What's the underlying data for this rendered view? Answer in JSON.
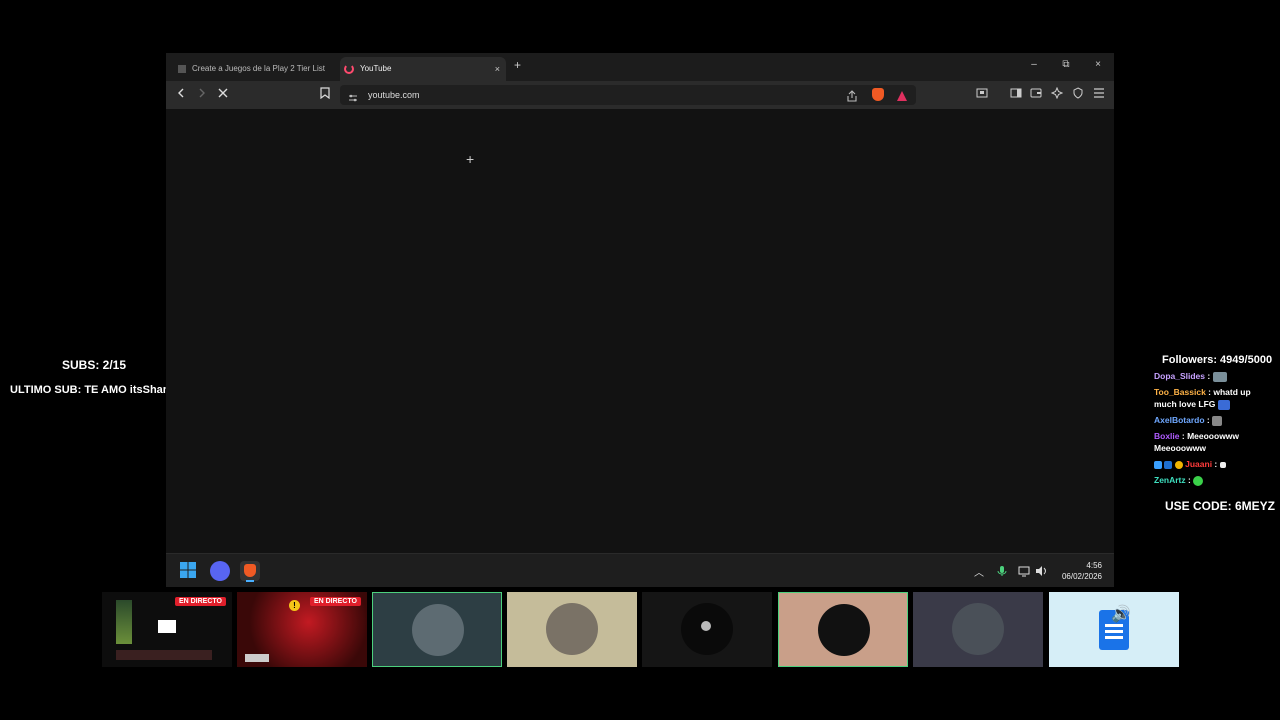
{
  "browser": {
    "tabs": [
      {
        "title": "Create a Juegos de la Play 2 Tier List"
      },
      {
        "title": "YouTube"
      }
    ],
    "url": "youtube.com",
    "icons": {
      "new_tab": "+",
      "close_tab": "×",
      "minimize": "–",
      "restore": "⧉",
      "close_window": "×"
    }
  },
  "taskbar": {
    "time": "4:56",
    "date": "06/02/2026"
  },
  "overlay": {
    "subs": "SUBS: 2/15",
    "last_sub": "ULTIMO SUB: TE AMO itsShanime",
    "followers": "Followers: 4949/5000",
    "code": "USE CODE: 6MEYZ"
  },
  "chat": [
    {
      "user": "Dopa_Slides",
      "color": "#c7a2ff",
      "message": ""
    },
    {
      "user": "Too_Bassick",
      "color": "#ffb347",
      "message": "whatd up much love LFG"
    },
    {
      "user": "AxelBotardo",
      "color": "#6fa8ff",
      "message": ""
    },
    {
      "user": "Boxlie",
      "color": "#b05cff",
      "message": "Meeooowww Meeooowww"
    },
    {
      "user": "Juaani",
      "color": "#ff3b3b",
      "message": ""
    },
    {
      "user": "ZenArtz",
      "color": "#3ee0c0",
      "message": ""
    }
  ],
  "thumbnails": [
    {
      "live_label": "EN DIRECTO"
    },
    {
      "live_label": "EN DIRECTO"
    }
  ]
}
